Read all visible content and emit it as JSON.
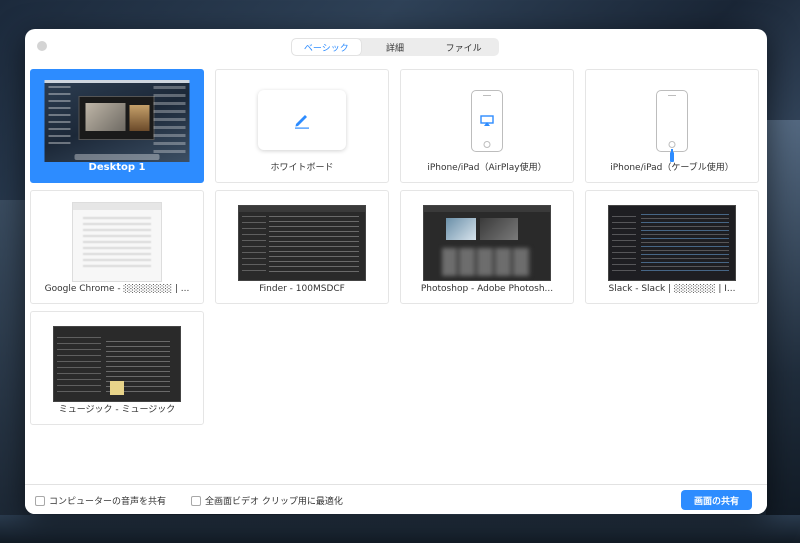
{
  "tabs": [
    {
      "label": "ベーシック",
      "active": true
    },
    {
      "label": "詳細",
      "active": false
    },
    {
      "label": "ファイル",
      "active": false
    }
  ],
  "sources": [
    {
      "label": "Desktop 1",
      "selected": true,
      "icon": "desktop-thumbnail"
    },
    {
      "label": "ホワイトボード",
      "selected": false,
      "icon": "pencil-icon"
    },
    {
      "label": "iPhone/iPad（AirPlay使用）",
      "selected": false,
      "icon": "airplay-icon"
    },
    {
      "label": "iPhone/iPad（ケーブル使用）",
      "selected": false,
      "icon": "cable-icon"
    },
    {
      "label": "Google Chrome - ░░░░░░░ | ...",
      "selected": false,
      "icon": "window-thumbnail"
    },
    {
      "label": "Finder - 100MSDCF",
      "selected": false,
      "icon": "window-thumbnail"
    },
    {
      "label": "Photoshop - Adobe Photosh...",
      "selected": false,
      "icon": "window-thumbnail"
    },
    {
      "label": "Slack - Slack | ░░░░░░ | I...",
      "selected": false,
      "icon": "window-thumbnail"
    },
    {
      "label": "ミュージック - ミュージック",
      "selected": false,
      "icon": "window-thumbnail"
    }
  ],
  "footer": {
    "share_audio_label": "コンピューターの音声を共有",
    "share_audio_checked": false,
    "optimize_video_label": "全画面ビデオ クリップ用に最適化",
    "optimize_video_checked": false,
    "share_button_label": "画面の共有"
  },
  "colors": {
    "accent": "#2d8cff"
  }
}
